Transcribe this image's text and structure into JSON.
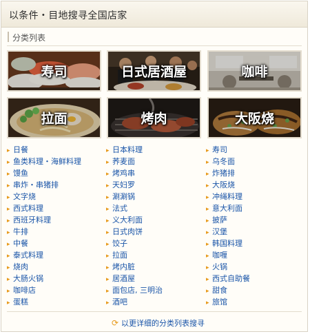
{
  "header": {
    "title": "以条件・目地搜寻全国店家"
  },
  "section": {
    "title": "分类列表"
  },
  "tiles": [
    {
      "label": "寿司",
      "icon": "sushi-photo"
    },
    {
      "label": "日式居酒屋",
      "icon": "izakaya-photo"
    },
    {
      "label": "咖啡",
      "icon": "cafe-photo"
    },
    {
      "label": "拉面",
      "icon": "ramen-photo"
    },
    {
      "label": "烤肉",
      "icon": "yakiniku-photo"
    },
    {
      "label": "大阪烧",
      "icon": "okonomiyaki-photo"
    }
  ],
  "columns": [
    [
      "日餐",
      "鱼类料理・海鲜料理",
      "馒鱼",
      "串炸・串猪排",
      "文字烧",
      "西式料理",
      "西班牙料理",
      "牛排",
      "中餐",
      "泰式料理",
      "烧肉",
      "大肠火锅",
      "咖啡店",
      "蛋糕"
    ],
    [
      "日本料理",
      "荞麦面",
      "烤鸡串",
      "天妇罗",
      "涮涮锅",
      "法式",
      "义大利面",
      "日式肉饼",
      "饺子",
      "拉面",
      "烤内脏",
      "居酒屋",
      "面包店, 三明治",
      "酒吧"
    ],
    [
      "寿司",
      "乌冬面",
      "炸猪排",
      "大阪烧",
      "冲绳料理",
      "意大利面",
      "披萨",
      "汉堡",
      "韩国料理",
      "咖喱",
      "火锅",
      "西式自助餐",
      "甜食",
      "旅馆"
    ]
  ],
  "more_link": {
    "label": "以更详细的分类列表搜寻",
    "icon": "refresh-icon"
  },
  "colors": {
    "link": "#1a55a8",
    "bullet": "#e79a1b",
    "frame": "#d8d2c4"
  }
}
